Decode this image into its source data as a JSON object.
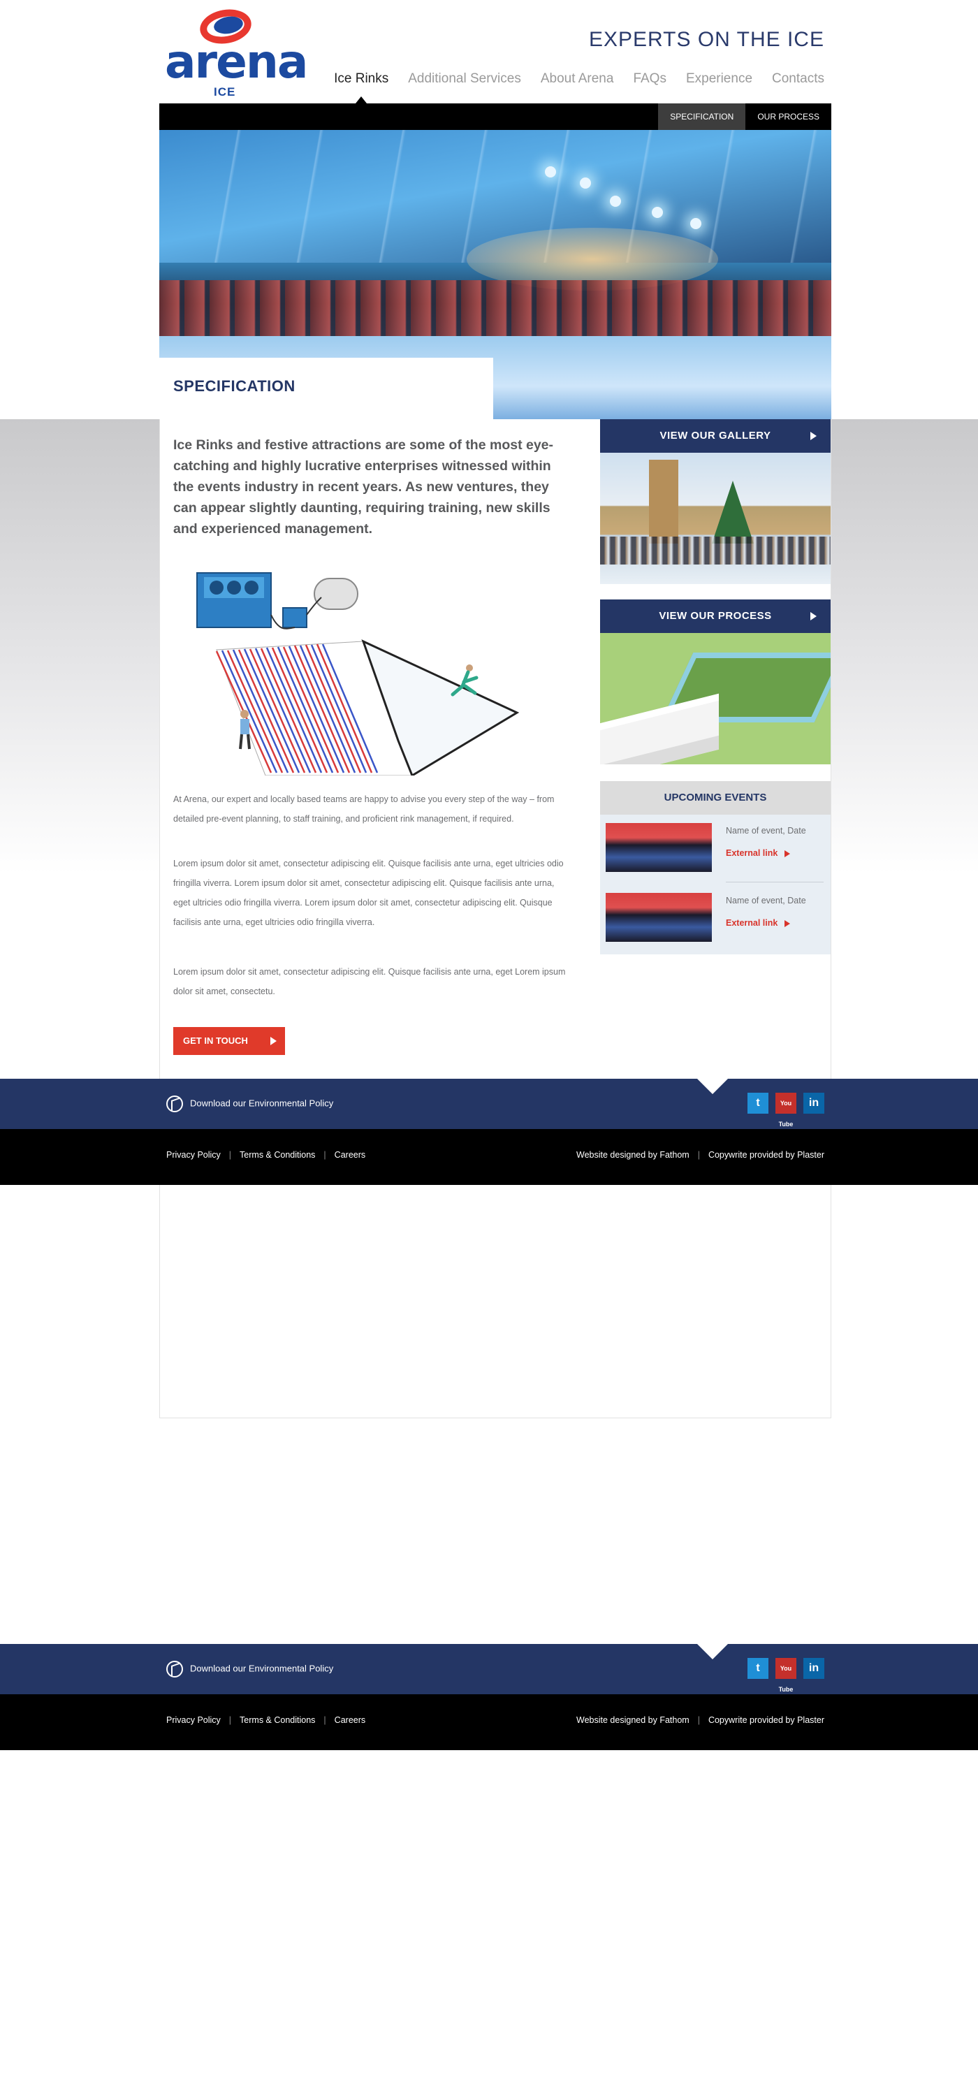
{
  "brand": {
    "logo_word": "arena",
    "logo_sub": "ICE",
    "tagline": "EXPERTS ON THE ICE"
  },
  "nav": {
    "items": [
      {
        "label": "Ice Rinks"
      },
      {
        "label": "Additional Services"
      },
      {
        "label": "About Arena"
      },
      {
        "label": "FAQs"
      },
      {
        "label": "Experience"
      },
      {
        "label": "Contacts"
      }
    ],
    "active": "Ice Rinks"
  },
  "subnav": {
    "tabs": [
      {
        "label": "SPECIFICATION"
      },
      {
        "label": "OUR PROCESS"
      }
    ],
    "active": "SPECIFICATION"
  },
  "hero": {
    "caption": "SPECIFICATION"
  },
  "main": {
    "intro": "Ice Rinks and festive attractions are some of the most eye-catching and highly lucrative enterprises witnessed within the events industry in recent years.  As new ventures, they can appear slightly daunting, requiring training, new skills and experienced management.",
    "para1": "At Arena, our expert and locally based teams are happy to advise you every step of the way – from detailed pre-event planning, to staff training, and proficient rink management, if required.",
    "para2": "Lorem ipsum dolor sit amet, consectetur adipiscing elit. Quisque facilisis ante urna, eget ultricies odio fringilla viverra. Lorem ipsum dolor sit amet, consectetur adipiscing elit. Quisque facilisis ante urna, eget ultricies odio fringilla viverra. Lorem ipsum dolor sit amet, consectetur adipiscing elit. Quisque facilisis ante urna, eget ultricies odio fringilla viverra.",
    "para3": "Lorem ipsum dolor sit amet, consectetur adipiscing elit. Quisque facilisis ante urna, eget  Lorem ipsum dolor sit amet, consectetu.",
    "cta": "GET IN TOUCH"
  },
  "sidebar": {
    "gallery_label": "VIEW OUR GALLERY",
    "process_label": "VIEW OUR PROCESS",
    "events_title": "UPCOMING EVENTS",
    "events": [
      {
        "name": "Name of event, Date",
        "link": "External link"
      },
      {
        "name": "Name of event, Date",
        "link": "External link"
      }
    ]
  },
  "footer": {
    "env_policy": "Download our Environmental Policy",
    "social": {
      "twitter": "t",
      "youtube": "You Tube",
      "linkedin": "in"
    },
    "links": [
      "Privacy Policy",
      "Terms & Conditions",
      "Careers"
    ],
    "credits": [
      "Website designed by Fathom",
      "Copywrite provided by Plaster"
    ]
  },
  "colors": {
    "navy": "#243665",
    "brand_blue": "#1c4aa0",
    "red": "#e03a2a",
    "black": "#000000"
  }
}
